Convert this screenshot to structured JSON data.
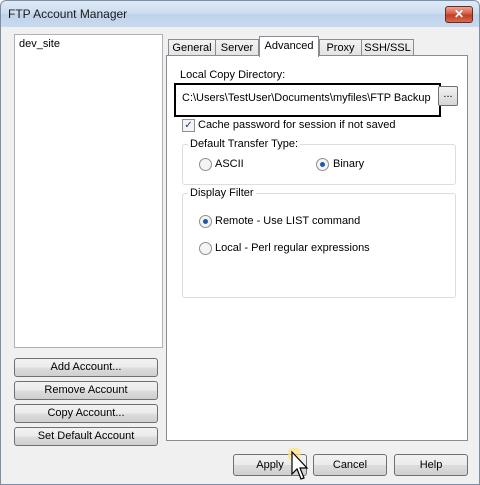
{
  "window": {
    "title": "FTP Account Manager",
    "close_glyph": "✕"
  },
  "accounts": {
    "items": [
      "dev_site"
    ]
  },
  "side_buttons": {
    "add": "Add Account...",
    "remove": "Remove Account",
    "copy": "Copy Account...",
    "set_default": "Set Default Account"
  },
  "tabs": [
    "General",
    "Server",
    "Advanced",
    "Proxy",
    "SSH/SSL"
  ],
  "active_tab": "Advanced",
  "advanced": {
    "local_copy_label": "Local Copy Directory:",
    "local_copy_value": "C:\\Users\\TestUser\\Documents\\myfiles\\FTP Backup",
    "browse_label": "...",
    "cache_password_label": "Cache password for session if not saved",
    "cache_password_checked": true,
    "transfer_type_title": "Default Transfer Type:",
    "transfer_ascii": "ASCII",
    "transfer_binary": "Binary",
    "transfer_selected": "Binary",
    "display_filter_title": "Display Filter",
    "filter_remote": "Remote - Use LIST command",
    "filter_local": "Local - Perl regular expressions",
    "filter_selected": "Remote - Use LIST command"
  },
  "bottom_buttons": {
    "apply": "Apply",
    "cancel": "Cancel",
    "help": "Help"
  },
  "checkmark_glyph": "✓",
  "colors": {
    "title_gradient": "#cbdcef",
    "close_red": "#c23a20",
    "radio_dot": "#1e5aa8"
  }
}
